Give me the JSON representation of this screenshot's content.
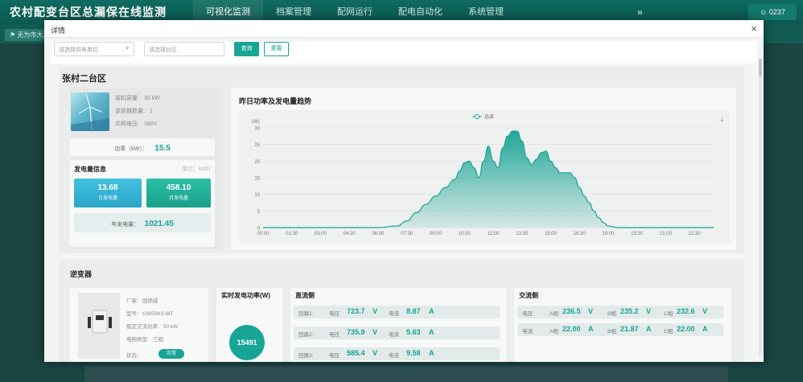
{
  "app": {
    "title": "农村配变台区总漏保在线监测",
    "nav": [
      "可视化监测",
      "档案管理",
      "配网运行",
      "配电自动化",
      "系统管理"
    ],
    "nav_more": "»",
    "user": "0237",
    "breadcrumb": "无为市大..."
  },
  "modal": {
    "title": "详情",
    "close": "×",
    "filters": {
      "unit_placeholder": "请选择供电单位",
      "area_placeholder": "请选择台区",
      "query_label": "查询",
      "reset_label": "重置"
    }
  },
  "station": {
    "name": "张村二台区",
    "specs": [
      {
        "label": "装机容量:",
        "value": "30 kW"
      },
      {
        "label": "逆变器数量:",
        "value": "1"
      },
      {
        "label": "并网电压:",
        "value": "380V"
      }
    ],
    "power_label": "功率（kW）：",
    "power_value": "15.5",
    "generation": {
      "title": "发电量信息",
      "unit": "单位：kWh",
      "day_value": "13.68",
      "day_label": "日发电量",
      "month_value": "458.10",
      "month_label": "月发电量",
      "year_label": "年发电量：",
      "year_value": "1021.45"
    }
  },
  "chart_data": {
    "type": "area",
    "title": "昨日功率及发电量趋势",
    "series": [
      {
        "name": "功率",
        "color": "#16a394"
      }
    ],
    "ylabel": "(W)",
    "ylim": [
      0,
      30
    ],
    "yticks": [
      0,
      5,
      10,
      15,
      20,
      25,
      30
    ],
    "xticks": [
      "00:00",
      "01:30",
      "03:00",
      "04:30",
      "06:00",
      "07:30",
      "09:00",
      "10:30",
      "12:00",
      "13:30",
      "15:00",
      "16:30",
      "18:00",
      "19:30",
      "21:00",
      "22:30"
    ],
    "points": [
      [
        "00:00",
        0
      ],
      [
        "06:00",
        0
      ],
      [
        "07:00",
        0.5
      ],
      [
        "07:30",
        2
      ],
      [
        "08:00",
        4.5
      ],
      [
        "08:30",
        7
      ],
      [
        "09:00",
        9.5
      ],
      [
        "09:30",
        12
      ],
      [
        "10:00",
        14.5
      ],
      [
        "10:15",
        17
      ],
      [
        "10:30",
        19.5
      ],
      [
        "10:45",
        20
      ],
      [
        "11:00",
        18
      ],
      [
        "11:15",
        15
      ],
      [
        "11:30",
        20
      ],
      [
        "11:45",
        24.5
      ],
      [
        "12:00",
        20
      ],
      [
        "12:15",
        18
      ],
      [
        "12:30",
        24
      ],
      [
        "12:45",
        27.5
      ],
      [
        "13:00",
        29
      ],
      [
        "13:15",
        29
      ],
      [
        "13:30",
        26
      ],
      [
        "13:45",
        21
      ],
      [
        "14:00",
        19
      ],
      [
        "14:15",
        20.5
      ],
      [
        "14:30",
        22.5
      ],
      [
        "14:45",
        23
      ],
      [
        "15:00",
        20
      ],
      [
        "15:15",
        18
      ],
      [
        "15:30",
        16.5
      ],
      [
        "16:00",
        16.5
      ],
      [
        "16:15",
        15
      ],
      [
        "16:30",
        12
      ],
      [
        "16:45",
        9.5
      ],
      [
        "17:00",
        7.5
      ],
      [
        "17:15",
        5
      ],
      [
        "17:30",
        3
      ],
      [
        "17:45",
        1.5
      ],
      [
        "18:00",
        0.5
      ],
      [
        "18:30",
        0
      ],
      [
        "23:30",
        0
      ]
    ]
  },
  "inverter": {
    "title": "逆变器",
    "specs": [
      {
        "label": "厂家:",
        "value": "固德威"
      },
      {
        "label": "型号:",
        "value": "GW50KS-MT"
      },
      {
        "label": "额定交流功率:",
        "value": "50 kW"
      },
      {
        "label": "电网类型:",
        "value": "三相"
      },
      {
        "label": "状态:",
        "value": ""
      }
    ],
    "status": "正常",
    "realtime_title": "实时发电功率(W)",
    "realtime_value": "15491",
    "dc": {
      "title": "直流侧",
      "rows": [
        {
          "name": "回路1:",
          "v_label": "电压",
          "v": "723.7",
          "v_unit": "V",
          "i_label": "电流",
          "i": "8.87",
          "i_unit": "A"
        },
        {
          "name": "回路2:",
          "v_label": "电压",
          "v": "735.9",
          "v_unit": "V",
          "i_label": "电流",
          "i": "5.63",
          "i_unit": "A"
        },
        {
          "name": "回路3:",
          "v_label": "电压",
          "v": "585.4",
          "v_unit": "V",
          "i_label": "电流",
          "i": "9.58",
          "i_unit": "A"
        }
      ]
    },
    "ac": {
      "title": "交流侧",
      "voltage": {
        "label": "电压:",
        "a_label": "A相",
        "a": "236.5",
        "b_label": "B相",
        "b": "235.2",
        "c_label": "C相",
        "c": "232.6",
        "unit": "V"
      },
      "current": {
        "label": "电流:",
        "a_label": "A相",
        "a": "22.00",
        "b_label": "B相",
        "b": "21.87",
        "c_label": "C相",
        "c": "22.00",
        "unit": "A"
      }
    }
  }
}
